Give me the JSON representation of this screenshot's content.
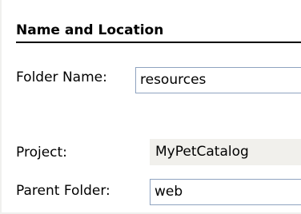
{
  "section": {
    "title": "Name and Location"
  },
  "fields": {
    "folder_name": {
      "label": "Folder Name:",
      "value": "resources"
    },
    "project": {
      "label": "Project:",
      "value": "MyPetCatalog"
    },
    "parent_folder": {
      "label": "Parent Folder:",
      "value": "web"
    }
  }
}
